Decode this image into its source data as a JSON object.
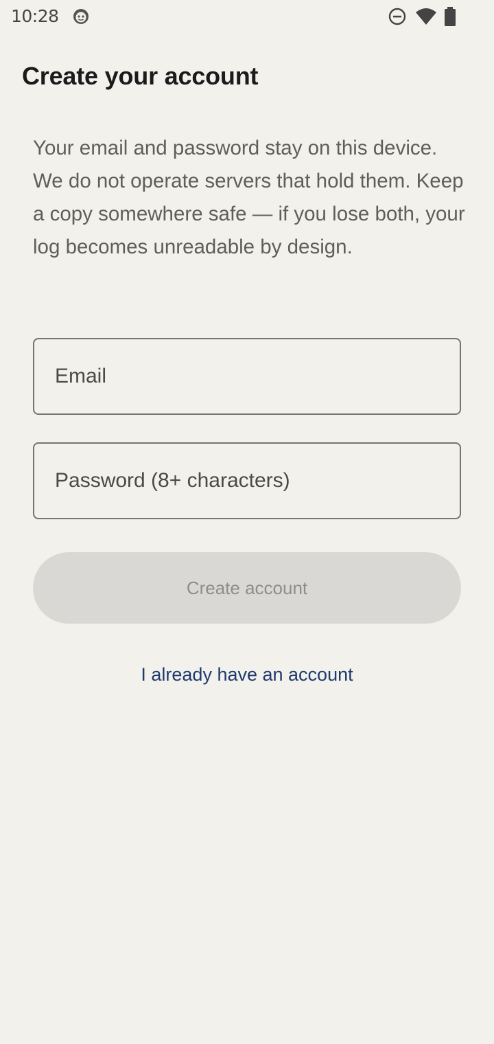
{
  "status_bar": {
    "time": "10:28",
    "icons": [
      "notification-icon",
      "do-not-disturb-icon",
      "wifi-icon",
      "battery-icon"
    ]
  },
  "page": {
    "title": "Create your account",
    "description": "Your email and password stay on this device. We do not operate servers that hold them. Keep a copy somewhere safe — if you lose both, your log becomes unreadable by design."
  },
  "form": {
    "email": {
      "value": "",
      "placeholder": "Email"
    },
    "password": {
      "value": "",
      "placeholder": "Password (8+ characters)"
    },
    "submit_label": "Create account",
    "submit_enabled": false,
    "signin_link_label": "I already have an account"
  },
  "colors": {
    "background": "#f3f1ec",
    "link": "#1f3a6e",
    "button_disabled_bg": "#d9d8d4",
    "button_disabled_text": "#8e8d8a",
    "field_border": "#77736d"
  }
}
